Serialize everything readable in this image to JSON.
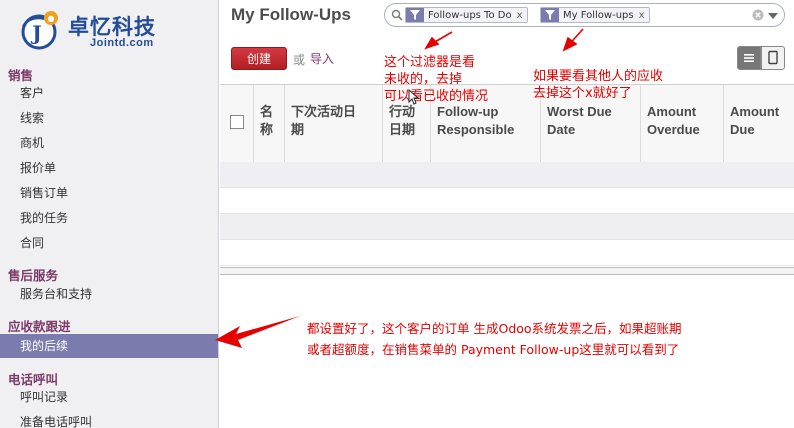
{
  "brand": {
    "name": "卓忆科技",
    "domain": "Jointd.com",
    "badge_letter": "J",
    "colors": {
      "primary": "#244c9a",
      "accent": "#f0a020"
    }
  },
  "sidebar": {
    "sections": [
      {
        "title": "销售",
        "items": [
          "客户",
          "线索",
          "商机",
          "报价单",
          "销售订单",
          "我的任务",
          "合同"
        ]
      },
      {
        "title": "售后服务",
        "items": [
          "服务台和支持"
        ]
      },
      {
        "title": "应收款跟进",
        "items": [
          "我的后续"
        ]
      },
      {
        "title": "电话呼叫",
        "items": [
          "呼叫记录",
          "准备电话呼叫"
        ]
      }
    ],
    "active_item": "我的后续"
  },
  "header": {
    "title": "My Follow-Ups",
    "search": {
      "facets": [
        {
          "label": "Follow-ups To Do",
          "remove": "x",
          "icon": "filter-icon"
        },
        {
          "label": "My Follow-ups",
          "remove": "x",
          "icon": "filter-icon"
        }
      ]
    }
  },
  "toolbar": {
    "create_label": "创建",
    "or_label": "或",
    "import_label": "导入"
  },
  "table": {
    "columns": [
      "名\n称",
      "下次活动日\n期",
      "行动\n日期",
      "Follow-up\nResponsible",
      "Worst Due\nDate",
      "Amount\nOverdue",
      "Amount\nDue"
    ]
  },
  "annotations": {
    "filter_note": "这个过滤器是看\n未收的，去掉\n可以看已收的情况",
    "others_note": "如果要看其他人的应收\n去掉这个x就好了",
    "menu_note": "都设置好了，这个客户的订单 生成Odoo系统发票之后，如果超账期\n或者超额度，在销售菜单的 Payment Follow-up这里就可以看到了",
    "color": "#e60000"
  }
}
